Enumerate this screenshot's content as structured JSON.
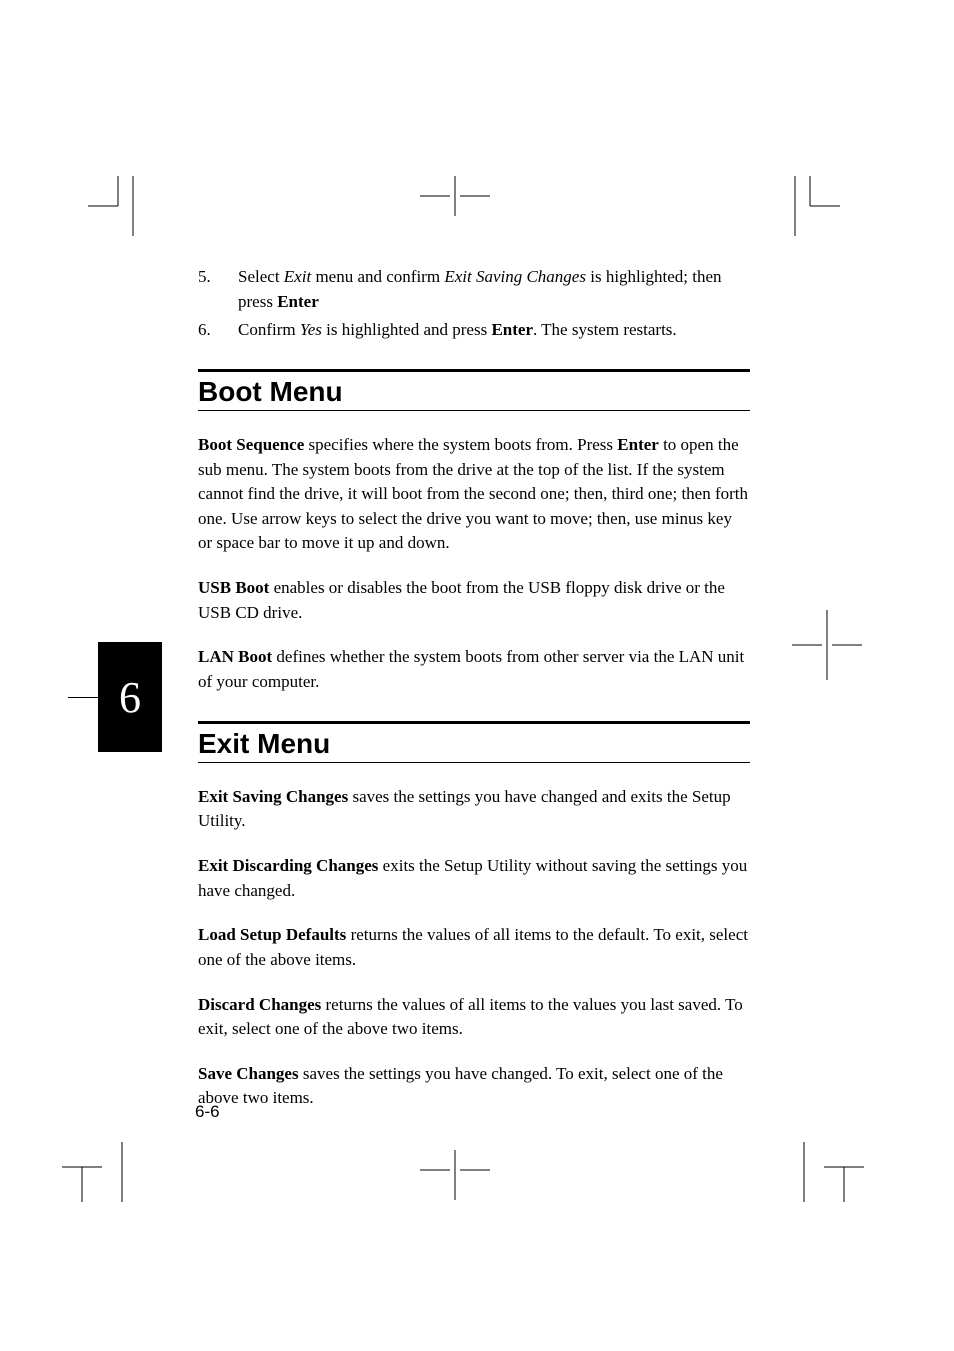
{
  "list": {
    "item5": {
      "num": "5.",
      "pre": "Select ",
      "i1": "Exit",
      "mid1": " menu and confirm ",
      "i2": "Exit Saving Changes",
      "mid2": " is highlighted; then press ",
      "b1": "Enter"
    },
    "item6": {
      "num": "6.",
      "pre": "Confirm ",
      "i1": "Yes",
      "mid1": " is highlighted and press ",
      "b1": "Enter",
      "post": ". The system restarts."
    }
  },
  "boot": {
    "heading": "Boot Menu",
    "p1": {
      "b1": "Boot Sequence",
      "t1": " specifies where the system boots from. Press ",
      "b2": "Enter",
      "t2": " to open the sub menu. The system boots from the drive at the top of the list. If the system cannot find the drive, it will boot from the second one; then, third one; then forth one. Use arrow keys to select the drive you want to move; then, use minus key or space bar to move it up and down."
    },
    "p2": {
      "b1": "USB Boot",
      "t1": " enables or disables the boot from the USB floppy disk drive or the USB CD drive."
    },
    "p3": {
      "b1": "LAN Boot",
      "t1": " defines whether the system boots from other server via the LAN unit of your computer."
    }
  },
  "exit": {
    "heading": "Exit Menu",
    "p1": {
      "b1": "Exit Saving Changes",
      "t1": " saves the settings you have changed and exits the Setup Utility."
    },
    "p2": {
      "b1": "Exit Discarding Changes",
      "t1": " exits the Setup Utility without saving the settings you have changed."
    },
    "p3": {
      "b1": "Load Setup Defaults",
      "t1": " returns the values of all items to the default.  To exit, select one of the above items."
    },
    "p4": {
      "b1": "Discard Changes",
      "t1": " returns the values of all items to the values you last saved. To exit, select one of the above two items."
    },
    "p5": {
      "b1": "Save Changes",
      "t1": " saves the settings you have changed. To exit, select one of the above two items."
    }
  },
  "chapter_tab": "6",
  "page_number": "6-6"
}
